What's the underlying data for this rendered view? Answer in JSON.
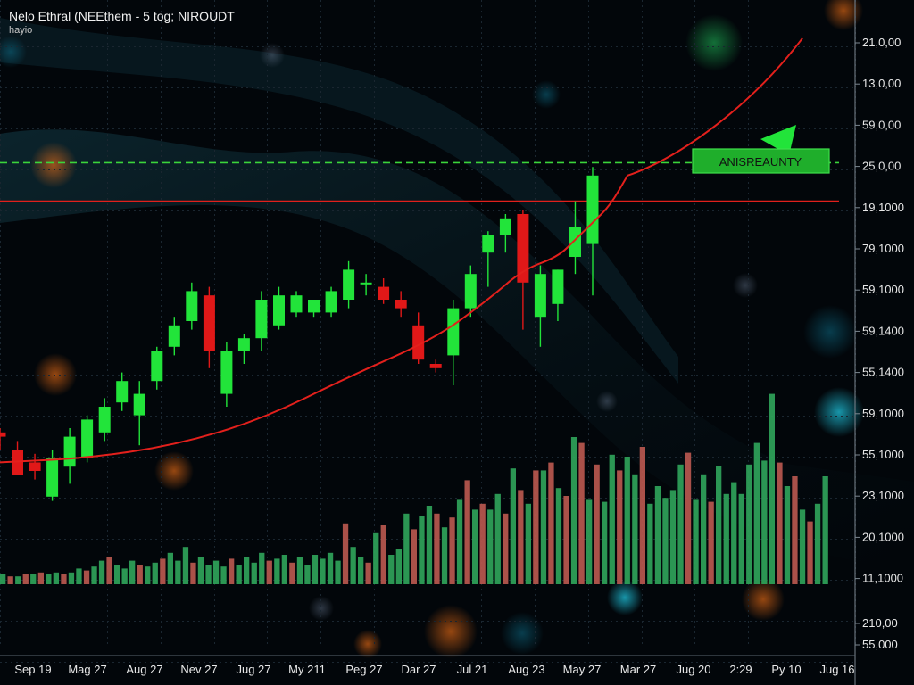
{
  "header": {
    "title": "Nelo Ethral (NEEthem - 5 tog; NIROUDT",
    "subtitle": "hayio"
  },
  "colors": {
    "up": "#22e43a",
    "down": "#e01818",
    "volume_up": "#2fa35a",
    "volume_down": "#b8584f",
    "trend": "#e3201c",
    "resistance": "#3bd43b",
    "support": "#e0201c",
    "axis_text": "#e8e8e8",
    "background": "#02060a"
  },
  "chart_data": {
    "type": "candlestick",
    "x_tick_labels": [
      "Sep 19",
      "Mag 27",
      "Aug 27",
      "Nev 27",
      "Jug 27",
      "My 211",
      "Peg 27",
      "Dar 27",
      "Jul 21",
      "Aug 23",
      "May 27",
      "Mar 27",
      "Jug 20",
      "2:29",
      "Py 10",
      "Jug 16"
    ],
    "y_tick_labels": [
      "21,0,00",
      "13,0,00",
      "59,0,00",
      "25,0,00",
      "19,1000",
      "79,1000",
      "59,1000",
      "59,1400",
      "55,1400",
      "59,1000",
      "55,1000",
      "23,1000",
      "20,1000",
      "11,1000",
      "210,00",
      "55,000"
    ],
    "price_ylim": [
      0,
      100
    ],
    "candles": [
      {
        "o": 24,
        "h": 25,
        "l": 20,
        "c": 23
      },
      {
        "o": 20,
        "h": 22,
        "l": 15,
        "c": 14
      },
      {
        "o": 17,
        "h": 19,
        "l": 13,
        "c": 15
      },
      {
        "o": 9,
        "h": 20,
        "l": 8,
        "c": 18
      },
      {
        "o": 16,
        "h": 25,
        "l": 12,
        "c": 23
      },
      {
        "o": 18,
        "h": 28,
        "l": 17,
        "c": 27
      },
      {
        "o": 24,
        "h": 32,
        "l": 22,
        "c": 30
      },
      {
        "o": 31,
        "h": 38,
        "l": 29,
        "c": 36
      },
      {
        "o": 28,
        "h": 36,
        "l": 21,
        "c": 33
      },
      {
        "o": 36,
        "h": 44,
        "l": 34,
        "c": 43
      },
      {
        "o": 44,
        "h": 51,
        "l": 42,
        "c": 49
      },
      {
        "o": 50,
        "h": 59,
        "l": 48,
        "c": 57
      },
      {
        "o": 56,
        "h": 58,
        "l": 39,
        "c": 43
      },
      {
        "o": 33,
        "h": 45,
        "l": 30,
        "c": 43
      },
      {
        "o": 43,
        "h": 47,
        "l": 40,
        "c": 46
      },
      {
        "o": 46,
        "h": 57,
        "l": 43,
        "c": 55
      },
      {
        "o": 49,
        "h": 58,
        "l": 48,
        "c": 56
      },
      {
        "o": 52,
        "h": 57,
        "l": 51,
        "c": 56
      },
      {
        "o": 52,
        "h": 54,
        "l": 51,
        "c": 55
      },
      {
        "o": 52,
        "h": 58,
        "l": 51,
        "c": 57
      },
      {
        "o": 55,
        "h": 64,
        "l": 53,
        "c": 62
      },
      {
        "o": 59,
        "h": 61,
        "l": 56,
        "c": 59
      },
      {
        "o": 58,
        "h": 60,
        "l": 54,
        "c": 55
      },
      {
        "o": 55,
        "h": 57,
        "l": 51,
        "c": 53
      },
      {
        "o": 49,
        "h": 52,
        "l": 40,
        "c": 41
      },
      {
        "o": 40,
        "h": 41,
        "l": 38,
        "c": 39
      },
      {
        "o": 42,
        "h": 55,
        "l": 35,
        "c": 53
      },
      {
        "o": 53,
        "h": 63,
        "l": 51,
        "c": 61
      },
      {
        "o": 66,
        "h": 71,
        "l": 58,
        "c": 70
      },
      {
        "o": 70,
        "h": 75,
        "l": 66,
        "c": 74
      },
      {
        "o": 75,
        "h": 76,
        "l": 48,
        "c": 59
      },
      {
        "o": 51,
        "h": 63,
        "l": 44,
        "c": 61
      },
      {
        "o": 54,
        "h": 62,
        "l": 50,
        "c": 62
      },
      {
        "o": 65,
        "h": 78,
        "l": 61,
        "c": 72
      },
      {
        "o": 68,
        "h": 86,
        "l": 56,
        "c": 84
      }
    ],
    "volume_ylim": [
      0,
      100
    ],
    "volume": [
      {
        "v": 5,
        "up": true
      },
      {
        "v": 4,
        "up": false
      },
      {
        "v": 4,
        "up": true
      },
      {
        "v": 5,
        "up": false
      },
      {
        "v": 5,
        "up": true
      },
      {
        "v": 6,
        "up": false
      },
      {
        "v": 5,
        "up": true
      },
      {
        "v": 6,
        "up": true
      },
      {
        "v": 5,
        "up": false
      },
      {
        "v": 6,
        "up": true
      },
      {
        "v": 8,
        "up": true
      },
      {
        "v": 7,
        "up": false
      },
      {
        "v": 9,
        "up": true
      },
      {
        "v": 12,
        "up": true
      },
      {
        "v": 14,
        "up": false
      },
      {
        "v": 10,
        "up": true
      },
      {
        "v": 8,
        "up": true
      },
      {
        "v": 12,
        "up": true
      },
      {
        "v": 10,
        "up": false
      },
      {
        "v": 9,
        "up": true
      },
      {
        "v": 11,
        "up": true
      },
      {
        "v": 13,
        "up": false
      },
      {
        "v": 16,
        "up": true
      },
      {
        "v": 12,
        "up": true
      },
      {
        "v": 19,
        "up": true
      },
      {
        "v": 11,
        "up": false
      },
      {
        "v": 14,
        "up": true
      },
      {
        "v": 10,
        "up": true
      },
      {
        "v": 12,
        "up": true
      },
      {
        "v": 9,
        "up": true
      },
      {
        "v": 13,
        "up": false
      },
      {
        "v": 10,
        "up": true
      },
      {
        "v": 14,
        "up": true
      },
      {
        "v": 11,
        "up": true
      },
      {
        "v": 16,
        "up": true
      },
      {
        "v": 12,
        "up": false
      },
      {
        "v": 13,
        "up": true
      },
      {
        "v": 15,
        "up": true
      },
      {
        "v": 11,
        "up": false
      },
      {
        "v": 14,
        "up": true
      },
      {
        "v": 10,
        "up": true
      },
      {
        "v": 15,
        "up": true
      },
      {
        "v": 13,
        "up": true
      },
      {
        "v": 16,
        "up": true
      },
      {
        "v": 12,
        "up": true
      },
      {
        "v": 31,
        "up": false
      },
      {
        "v": 19,
        "up": true
      },
      {
        "v": 14,
        "up": true
      },
      {
        "v": 11,
        "up": false
      },
      {
        "v": 26,
        "up": true
      },
      {
        "v": 30,
        "up": false
      },
      {
        "v": 15,
        "up": true
      },
      {
        "v": 18,
        "up": true
      },
      {
        "v": 36,
        "up": true
      },
      {
        "v": 28,
        "up": false
      },
      {
        "v": 35,
        "up": true
      },
      {
        "v": 40,
        "up": true
      },
      {
        "v": 36,
        "up": false
      },
      {
        "v": 29,
        "up": true
      },
      {
        "v": 34,
        "up": false
      },
      {
        "v": 43,
        "up": true
      },
      {
        "v": 53,
        "up": false
      },
      {
        "v": 38,
        "up": true
      },
      {
        "v": 41,
        "up": false
      },
      {
        "v": 38,
        "up": true
      },
      {
        "v": 46,
        "up": true
      },
      {
        "v": 36,
        "up": false
      },
      {
        "v": 59,
        "up": true
      },
      {
        "v": 48,
        "up": false
      },
      {
        "v": 41,
        "up": true
      },
      {
        "v": 58,
        "up": false
      },
      {
        "v": 58,
        "up": true
      },
      {
        "v": 62,
        "up": false
      },
      {
        "v": 49,
        "up": true
      },
      {
        "v": 45,
        "up": false
      },
      {
        "v": 75,
        "up": true
      },
      {
        "v": 72,
        "up": false
      },
      {
        "v": 43,
        "up": true
      },
      {
        "v": 61,
        "up": false
      },
      {
        "v": 42,
        "up": true
      },
      {
        "v": 66,
        "up": true
      },
      {
        "v": 58,
        "up": false
      },
      {
        "v": 65,
        "up": true
      },
      {
        "v": 56,
        "up": true
      },
      {
        "v": 70,
        "up": false
      },
      {
        "v": 41,
        "up": true
      },
      {
        "v": 50,
        "up": true
      },
      {
        "v": 44,
        "up": true
      },
      {
        "v": 48,
        "up": true
      },
      {
        "v": 61,
        "up": true
      },
      {
        "v": 67,
        "up": false
      },
      {
        "v": 43,
        "up": true
      },
      {
        "v": 56,
        "up": true
      },
      {
        "v": 42,
        "up": false
      },
      {
        "v": 60,
        "up": true
      },
      {
        "v": 46,
        "up": true
      },
      {
        "v": 52,
        "up": true
      },
      {
        "v": 46,
        "up": true
      },
      {
        "v": 61,
        "up": true
      },
      {
        "v": 72,
        "up": true
      },
      {
        "v": 63,
        "up": true
      },
      {
        "v": 97,
        "up": true
      },
      {
        "v": 62,
        "up": false
      },
      {
        "v": 50,
        "up": true
      },
      {
        "v": 55,
        "up": false
      },
      {
        "v": 38,
        "up": true
      },
      {
        "v": 32,
        "up": false
      },
      {
        "v": 41,
        "up": true
      },
      {
        "v": 55,
        "up": true
      }
    ],
    "trend_line": [
      [
        0,
        17
      ],
      [
        5,
        18
      ],
      [
        10,
        21
      ],
      [
        15,
        27
      ],
      [
        20,
        37
      ],
      [
        25,
        46
      ],
      [
        28,
        55
      ],
      [
        30,
        62
      ],
      [
        32,
        65
      ],
      [
        33,
        69
      ],
      [
        34,
        73
      ],
      [
        35,
        77
      ],
      [
        36,
        84
      ]
    ],
    "resistance_level": 87,
    "support_level": 78,
    "annotation": {
      "text": "ANISREAUNTY"
    }
  }
}
